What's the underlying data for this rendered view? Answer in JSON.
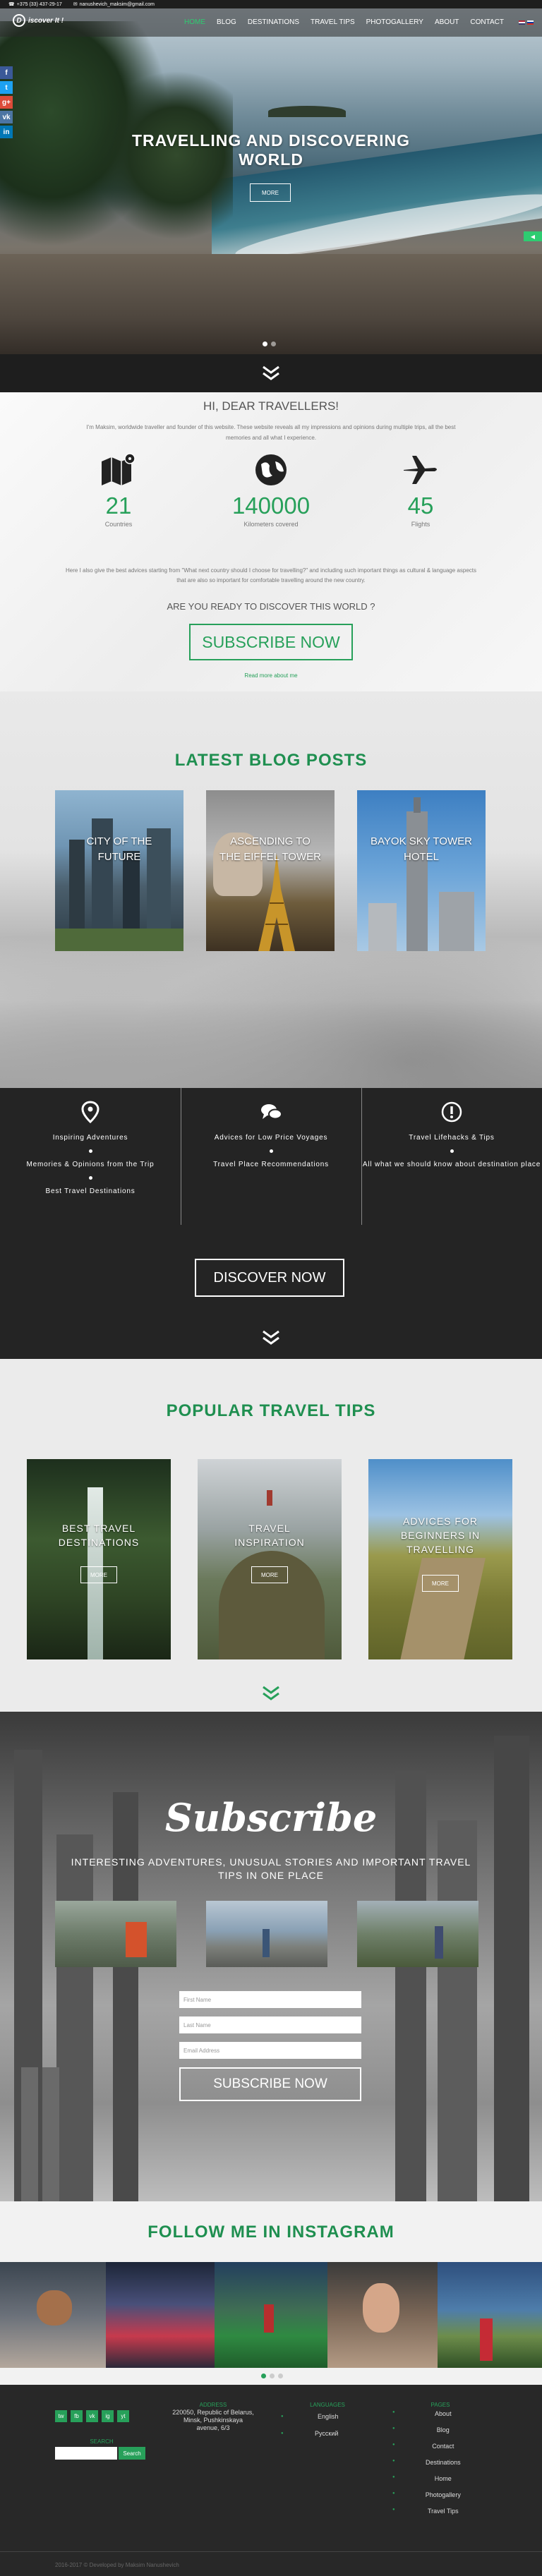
{
  "topbar": {
    "phone": "+375 (33) 437-29-17",
    "email": "nanushevich_maksim@gmail.com"
  },
  "brand": {
    "logo_letter": "D",
    "logo_text": "iscover It !"
  },
  "nav": {
    "items": [
      "Home",
      "Blog",
      "Destinations",
      "Travel tips",
      "Photogallery",
      "About",
      "Contact"
    ]
  },
  "hero": {
    "title_line1": "TRAVELLING AND DISCOVERING",
    "title_line2": "WORLD",
    "button": "MORE",
    "side_tab": "◀"
  },
  "social": [
    "f",
    "t",
    "g+",
    "vk",
    "in"
  ],
  "intro": {
    "heading": "HI, DEAR TRAVELLERS!",
    "text": "I'm Maksim, worldwide traveller and founder of this website. These website reveals all my impressions and opinions during multiple trips, all the best memories and all what I experience.",
    "stats": [
      {
        "number": "21",
        "label": "Countries"
      },
      {
        "number": "140000",
        "label": "Kilometers covered"
      },
      {
        "number": "45",
        "label": "Flights"
      }
    ],
    "text2": "Here I also give the best advices starting from \"What next country should I choose for travelling?\" and including such important things as cultural & language aspects that are also so important for comfortable travelling around the new country.",
    "question": "ARE YOU READY TO DISCOVER THIS WORLD ?",
    "button": "SUBSCRIBE NOW",
    "read_more": "Read more about me"
  },
  "blog": {
    "title": "LATEST BLOG POSTS",
    "posts": [
      {
        "title_line1": "CITY OF THE",
        "title_line2": "FUTURE"
      },
      {
        "title_line1": "ASCENDING TO",
        "title_line2": "THE EIFFEL TOWER"
      },
      {
        "title_line1": "BAYOK SKY TOWER",
        "title_line2": "HOTEL"
      }
    ]
  },
  "features": {
    "columns": [
      {
        "icon": "map-pin-icon",
        "items": [
          "Inspiring Adventures",
          "Memories & Opinions from the Trip",
          "Best Travel Destinations"
        ]
      },
      {
        "icon": "chat-bubbles-icon",
        "items": [
          "Advices for Low Price Voyages",
          "Travel Place Recommendations"
        ]
      },
      {
        "icon": "exclamation-icon",
        "items": [
          "Travel Lifehacks & Tips",
          "All what we should know about destination place"
        ]
      }
    ],
    "button": "DISCOVER NOW"
  },
  "tips": {
    "title": "POPULAR TRAVEL TIPS",
    "cards": [
      {
        "title_line1": "BEST TRAVEL",
        "title_line2": "DESTINATIONS",
        "button": "MORE"
      },
      {
        "title_line1": "TRAVEL",
        "title_line2": "INSPIRATION",
        "button": "MORE"
      },
      {
        "title_line1": "ADVICES FOR",
        "title_line2": "BEGINNERS IN",
        "title_line3": "TRAVELLING",
        "button": "MORE"
      }
    ]
  },
  "subscribe": {
    "title": "Subscribe",
    "subtitle_line1": "INTERESTING ADVENTURES, UNUSUAL STORIES AND IMPORTANT TRAVEL",
    "subtitle_line2": "TIPS IN ONE PLACE",
    "fields": {
      "first_name": "First Name",
      "last_name": "Last Name",
      "email": "Email Address"
    },
    "button": "SUBSCRIBE NOW"
  },
  "instagram": {
    "title": "FOLLOW ME IN INSTAGRAM"
  },
  "footer": {
    "social_icons": [
      "tw",
      "fb",
      "vk",
      "ig",
      "yt"
    ],
    "search_label": "SEARCH",
    "search_button": "Search",
    "address_label": "ADDRESS",
    "address_line1": "220050, Republic of Belarus,",
    "address_line2": "Minsk, Pushkinskaya",
    "address_line3": "avenue, 6/3",
    "languages_label": "LANGUAGES",
    "languages": [
      "English",
      "Русский"
    ],
    "pages_label": "PAGES",
    "pages": [
      "About",
      "Blog",
      "Contact",
      "Destinations",
      "Home",
      "Photogallery",
      "Travel Tips"
    ],
    "copyright": "2016-2017 © Developed by Maksim Nanushevich"
  },
  "colors": {
    "accent": "#27a05a",
    "dark": "#242424"
  }
}
